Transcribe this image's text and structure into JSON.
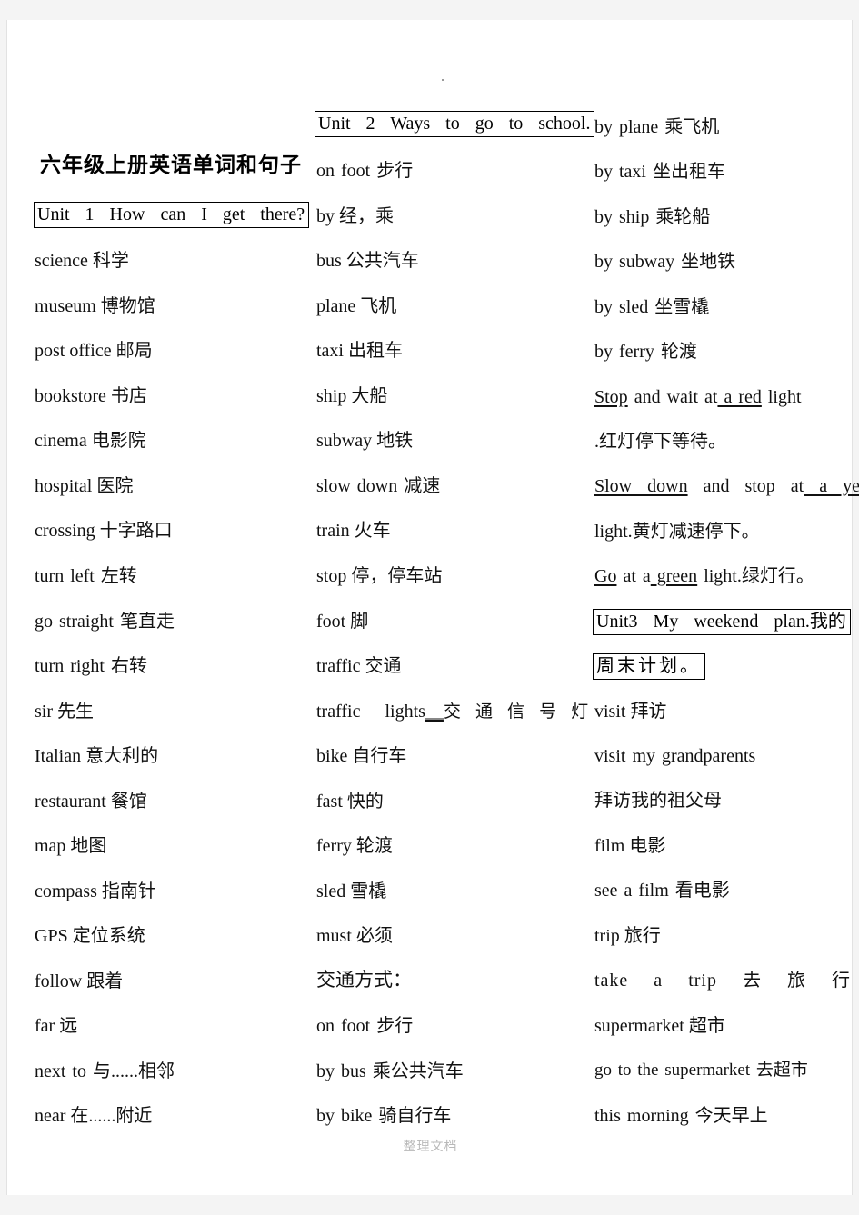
{
  "document": {
    "title": "六年级上册英语单词和句子",
    "footer_watermark": "整理文档",
    "page_background": "#ffffff",
    "text_color": "#000000",
    "watermark_color": "#b9b9b9"
  },
  "columns": {
    "left": {
      "heading_box": "Unit 1    How can I get there?",
      "entries": [
        "science 科学",
        "museum 博物馆",
        " post office 邮局",
        "bookstore 书店",
        "cinema 电影院",
        "hospital 医院",
        "crossing 十字路口",
        "turn left 左转",
        "go straight 笔直走",
        "turn right 右转",
        "sir 先生",
        "Italian 意大利的",
        "restaurant 餐馆",
        "map 地图",
        "compass  指南针",
        "GPS 定位系统",
        "follow 跟着",
        "far 远",
        "next to  与......相邻",
        "near 在......附近"
      ]
    },
    "middle": {
      "heading_box": "Unit 2    Ways to go to school.",
      "entries": [
        "on foot 步行",
        "by  经，乘",
        "bus 公共汽车",
        "plane 飞机",
        "taxi 出租车",
        "ship 大船",
        "subway 地铁",
        "slow down 减速",
        "train 火车",
        "stop 停，停车站",
        "foot 脚",
        "traffic 交通",
        "traffic  lights__交 通 信 号 灯",
        "bike 自行车",
        "fast 快的",
        "ferry 轮渡",
        "sled 雪橇",
        "must 必须",
        "交通方式：",
        "on foot 步行",
        "by bus 乘公共汽车",
        "by bike 骑自行车"
      ],
      "traffic_lights_line": {
        "english": "traffic    lights",
        "underline_run": "__",
        "chinese": "交 通 信 号 灯"
      }
    },
    "right": {
      "entries_top": [
        "by plane 乘飞机",
        "by taxi 坐出租车",
        "by ship 乘轮船",
        "by subway 坐地铁",
        "by sled 坐雪橇",
        "by ferry 轮渡"
      ],
      "sentences": [
        {
          "parts": [
            {
              "text": "Stop",
              "underline": true
            },
            {
              "text": " and wait at",
              "underline": false
            },
            {
              "text": " a red",
              "underline": true
            },
            {
              "text": " light",
              "underline": false
            }
          ],
          "translation": ".红灯停下等待。"
        },
        {
          "parts": [
            {
              "text": "Slow down",
              "underline": true
            },
            {
              "text": " and stop at",
              "underline": false
            },
            {
              "text": " a yellow",
              "underline": true
            }
          ],
          "translation": "light.黄灯减速停下。"
        },
        {
          "parts": [
            {
              "text": "Go",
              "underline": true
            },
            {
              "text": " at a",
              "underline": false
            },
            {
              "text": " green",
              "underline": true
            },
            {
              "text": " light.绿灯行。",
              "underline": false
            }
          ],
          "translation": ""
        }
      ],
      "heading_box_line1": "Unit3    My weekend plan.我的",
      "heading_box_line2": "周末计划。",
      "entries_bottom": [
        "visit  拜访",
        "visit my grandparents",
        "拜访我的祖父母",
        "film 电影",
        "see a film  看电影",
        "trip 旅行",
        "take a trip 去 旅 行",
        "supermarket 超市",
        "go to the supermarket 去超市",
        "this morning 今天早上"
      ]
    }
  }
}
